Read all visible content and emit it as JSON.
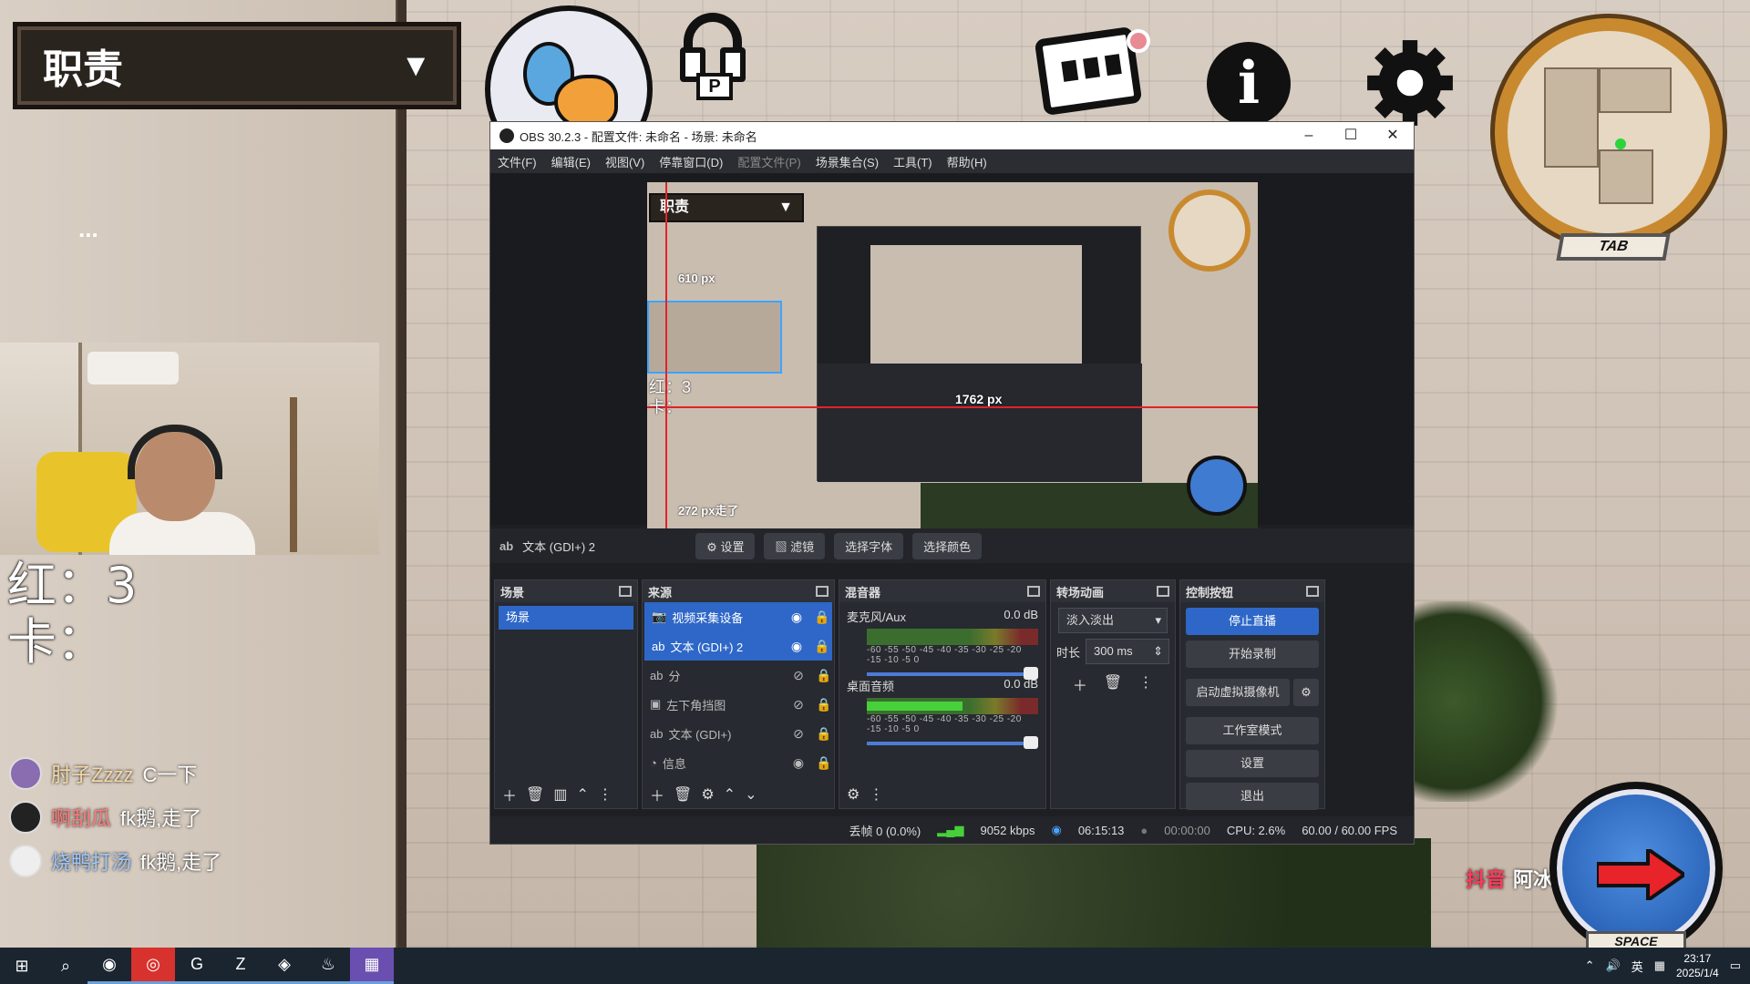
{
  "game": {
    "role_dropdown": "职责",
    "role_caret": "▼",
    "p_key": "P",
    "tab_key": "TAB",
    "space_key": "SPACE",
    "dots": "...",
    "overlay_text_line1": "红：3",
    "overlay_text_line2": "卡：",
    "watermark_brand": "抖音",
    "watermark_user": "阿冰fps"
  },
  "chat": [
    {
      "user": "肘子Zzzz",
      "text": "C一下"
    },
    {
      "user": "啊刮瓜",
      "text": "fk鹅,走了"
    },
    {
      "user": "烧鸭打汤",
      "text": "fk鹅,走了"
    }
  ],
  "obs": {
    "title": "OBS 30.2.3 - 配置文件: 未命名 - 场景: 未命名",
    "menu": [
      "文件(F)",
      "编辑(E)",
      "视图(V)",
      "停靠窗口(D)",
      "配置文件(P)",
      "场景集合(S)",
      "工具(T)",
      "帮助(H)"
    ],
    "preview": {
      "dropdown": "职责",
      "dim_610": "610 px",
      "dim_1762": "1762 px",
      "dim_272": "272 px走了",
      "text_line1": "红：3",
      "text_line2": "卡："
    },
    "props_bar": {
      "source_name": "文本 (GDI+) 2",
      "settings": "设置",
      "filters": "滤镜",
      "choose_font": "选择字体",
      "choose_color": "选择颜色"
    },
    "docks": {
      "scenes_title": "场景",
      "sources_title": "来源",
      "mixer_title": "混音器",
      "transitions_title": "转场动画",
      "controls_title": "控制按钮"
    },
    "scenes": [
      "场景"
    ],
    "sources": [
      {
        "name": "视频采集设备",
        "visible": true,
        "selected": true
      },
      {
        "name": "文本 (GDI+) 2",
        "visible": true,
        "selected": true
      },
      {
        "name": "分",
        "visible": false,
        "selected": false
      },
      {
        "name": "左下角挡图",
        "visible": false,
        "selected": false
      },
      {
        "name": "文本 (GDI+)",
        "visible": false,
        "selected": false
      },
      {
        "name": "信息",
        "visible": true,
        "selected": false
      }
    ],
    "mixer": [
      {
        "name": "麦克风/Aux",
        "db": "0.0 dB",
        "level": 0.0
      },
      {
        "name": "桌面音频",
        "db": "0.0 dB",
        "level": 0.56
      }
    ],
    "meter_scale": "-60 -55 -50 -45 -40 -35 -30 -25 -20 -15 -10 -5 0",
    "transition": {
      "type": "淡入淡出",
      "duration_label": "时长",
      "duration": "300 ms"
    },
    "controls": {
      "stop_stream": "停止直播",
      "start_record": "开始录制",
      "virtual_cam": "启动虚拟摄像机",
      "studio_mode": "工作室模式",
      "settings": "设置",
      "exit": "退出"
    },
    "status": {
      "dropped": "丢帧 0 (0.0%)",
      "bitrate": "9052 kbps",
      "live_time": "06:15:13",
      "rec_time": "00:00:00",
      "cpu": "CPU: 2.6%",
      "fps": "60.00 / 60.00 FPS"
    }
  },
  "taskbar": {
    "ime": "英",
    "time": "23:17",
    "date": "2025/1/4"
  },
  "colors": {
    "obs_accent": "#2e67c7",
    "guide_line": "#e0232a",
    "minimap_rim": "#c98a2f",
    "sprint_blue": "#3f7bd0"
  }
}
